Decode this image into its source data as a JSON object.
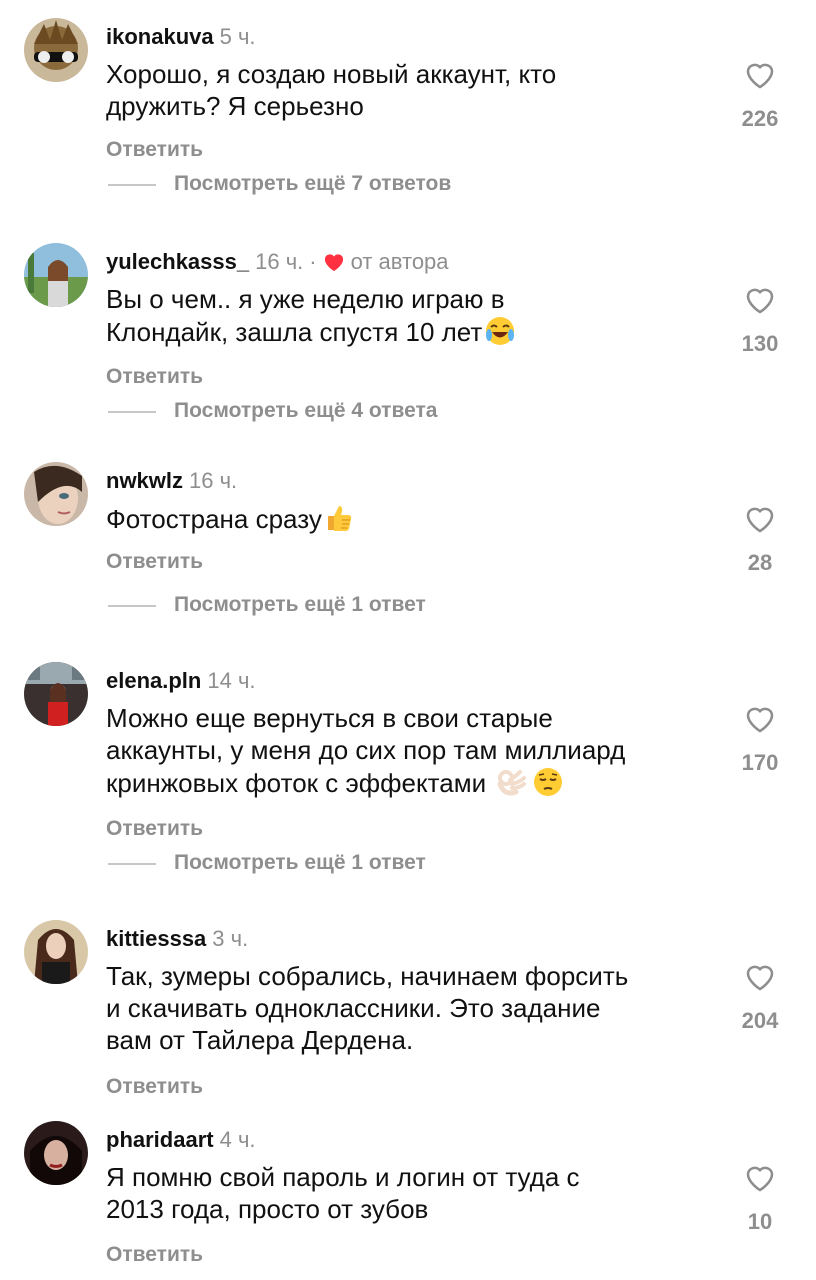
{
  "comments": [
    {
      "username": "ikonakuva",
      "time": "5 ч.",
      "text_lines": [
        "Хорошо, я создаю новый аккаунт, кто",
        "дружить? Я серьезно"
      ],
      "reply": "Ответить",
      "more": "Посмотреть ещё 7 ответов",
      "likes": "226"
    },
    {
      "username": "yulechkasss_",
      "time": "16 ч.",
      "author_label": "от автора",
      "text_lines": [
        "Вы о чем.. я уже неделю играю в",
        "Клондайк, зашла спустя 10 лет"
      ],
      "emoji": "tears-of-joy-emoji",
      "reply": "Ответить",
      "more": "Посмотреть ещё 4 ответа",
      "likes": "130"
    },
    {
      "username": "nwkwlz",
      "time": "16 ч.",
      "text_lines": [
        "Фотострана сразу"
      ],
      "emoji": "thumbs-up-emoji",
      "reply": "Ответить",
      "more": "Посмотреть ещё 1 ответ",
      "likes": "28"
    },
    {
      "username": "elena.pln",
      "time": "14 ч.",
      "text_lines": [
        "Можно еще вернуться в свои старые",
        "аккаунты, у меня до сих пор там миллиард",
        "кринжовых фоток с эффектами"
      ],
      "emoji": "ok-hand-and-pensive-emoji",
      "reply": "Ответить",
      "more": "Посмотреть ещё 1 ответ",
      "likes": "170"
    },
    {
      "username": "kittiesssa",
      "time": "3 ч.",
      "text_lines": [
        "Так, зумеры собрались, начинаем форсить",
        "и скачивать одноклассники. Это задание",
        "вам от Тайлера Дердена."
      ],
      "reply": "Ответить",
      "likes": "204"
    },
    {
      "username": "pharidaart",
      "time": "4 ч.",
      "text_lines": [
        "Я помню свой пароль и логин от туда с",
        "2013 года, просто от зубов"
      ],
      "reply": "Ответить",
      "likes": "10"
    }
  ],
  "colors": {
    "muted": "#8e8e8e",
    "author_heart": "#ff3040",
    "text": "#111111"
  }
}
